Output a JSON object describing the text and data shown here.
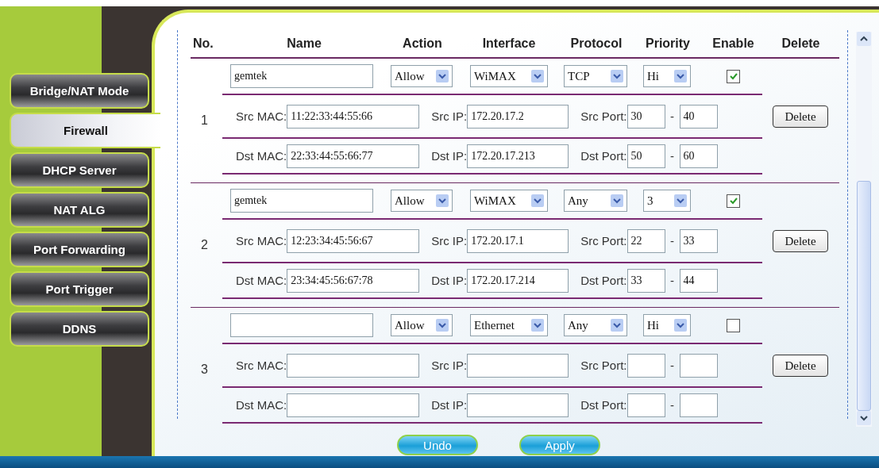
{
  "sidebar": {
    "items": [
      {
        "label": "Bridge/NAT Mode",
        "selected": false
      },
      {
        "label": "Firewall",
        "selected": true
      },
      {
        "label": "DHCP Server",
        "selected": false
      },
      {
        "label": "NAT ALG",
        "selected": false
      },
      {
        "label": "Port Forwarding",
        "selected": false
      },
      {
        "label": "Port Trigger",
        "selected": false
      },
      {
        "label": "DDNS",
        "selected": false
      }
    ]
  },
  "table": {
    "columns": [
      "No.",
      "Name",
      "Action",
      "Interface",
      "Protocol",
      "Priority",
      "Enable",
      "Delete"
    ],
    "rows": [
      {
        "no": "1",
        "name": "gemtek",
        "action": "Allow",
        "interface": "WiMAX",
        "protocol": "TCP",
        "priority": "Hi",
        "enabled": true,
        "src": {
          "mac_label": "Src MAC:",
          "mac": "11:22:33:44:55:66",
          "ip_label": "Src IP:",
          "ip": "172.20.17.2",
          "port_label": "Src Port:",
          "port_from": "30",
          "port_sep": "-",
          "port_to": "40"
        },
        "dst": {
          "mac_label": "Dst MAC:",
          "mac": "22:33:44:55:66:77",
          "ip_label": "Dst IP:",
          "ip": "172.20.17.213",
          "port_label": "Dst Port:",
          "port_from": "50",
          "port_sep": "-",
          "port_to": "60"
        },
        "delete_button": "Delete"
      },
      {
        "no": "2",
        "name": "gemtek",
        "action": "Allow",
        "interface": "WiMAX",
        "protocol": "Any",
        "priority": "3",
        "enabled": true,
        "src": {
          "mac_label": "Src MAC:",
          "mac": "12:23:34:45:56:67",
          "ip_label": "Src IP:",
          "ip": "172.20.17.1",
          "port_label": "Src Port:",
          "port_from": "22",
          "port_sep": "-",
          "port_to": "33"
        },
        "dst": {
          "mac_label": "Dst MAC:",
          "mac": "23:34:45:56:67:78",
          "ip_label": "Dst IP:",
          "ip": "172.20.17.214",
          "port_label": "Dst Port:",
          "port_from": "33",
          "port_sep": "-",
          "port_to": "44"
        },
        "delete_button": "Delete"
      },
      {
        "no": "3",
        "action": "Allow",
        "interface": "Ethernet",
        "protocol": "Any",
        "priority": "Hi",
        "enabled": false,
        "src": {
          "mac_label": "Src MAC:",
          "ip_label": "Src IP:",
          "port_label": "Src Port:",
          "port_sep": "-"
        },
        "dst": {
          "mac_label": "Dst MAC:",
          "ip_label": "Dst IP:",
          "port_label": "Dst Port:",
          "port_sep": "-"
        },
        "delete_button": "Delete"
      }
    ]
  },
  "buttons": [
    "Undo",
    "Apply"
  ]
}
